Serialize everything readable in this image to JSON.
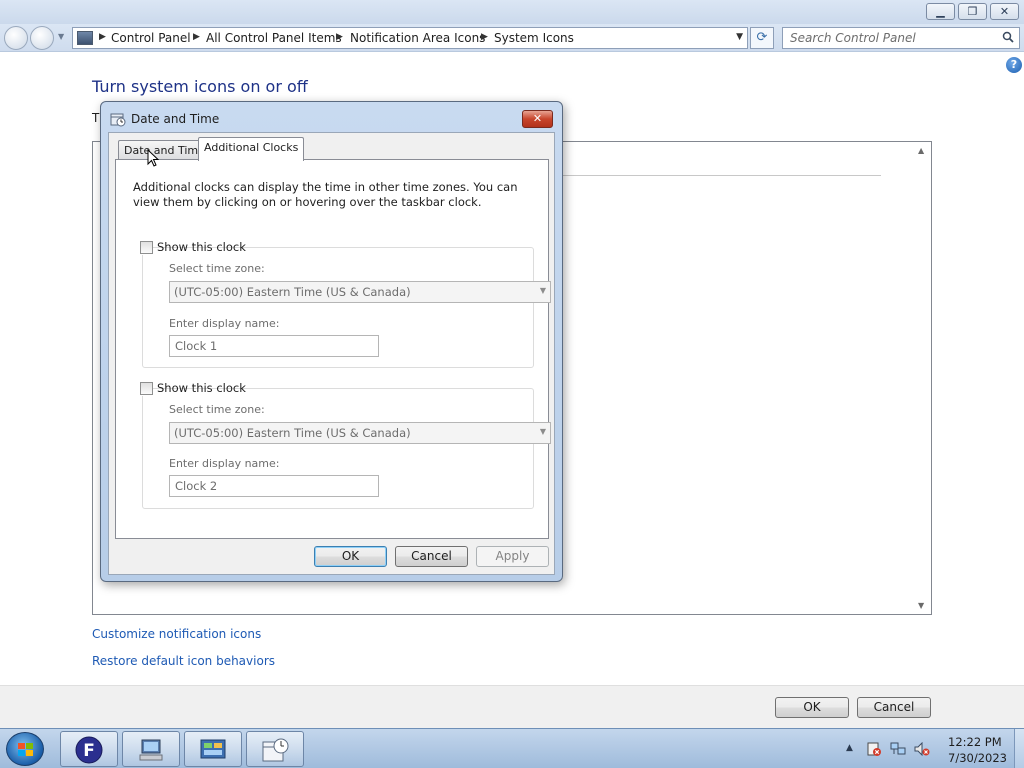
{
  "window": {
    "minimize_glyph": "▁",
    "maximize_glyph": "❐",
    "close_glyph": "✕"
  },
  "address_bar": {
    "breadcrumbs": [
      "Control Panel",
      "All Control Panel Items",
      "Notification Area Icons",
      "System Icons"
    ],
    "refresh_glyph": "⟳"
  },
  "search": {
    "placeholder": "Search Control Panel"
  },
  "content": {
    "help_glyph": "?",
    "title": "Turn system icons on or off",
    "subtitle": "T",
    "links": [
      "Customize notification icons",
      "Restore default icon behaviors"
    ]
  },
  "footer": {
    "ok_label": "OK",
    "cancel_label": "Cancel"
  },
  "dialog": {
    "title": "Date and Time",
    "close_glyph": "✕",
    "tabs": [
      "Date and Time",
      "Additional Clocks"
    ],
    "active_tab": "Additional Clocks",
    "description": "Additional clocks can display the time in other time zones. You can view them by clicking on or hovering over the taskbar clock.",
    "clocks": [
      {
        "checkbox_label": "Show this clock",
        "checked": false,
        "time_zone_label": "Select time zone:",
        "time_zone_value": "(UTC-05:00) Eastern Time (US & Canada)",
        "display_name_label": "Enter display name:",
        "display_name_value": "Clock 1"
      },
      {
        "checkbox_label": "Show this clock",
        "checked": false,
        "time_zone_label": "Select time zone:",
        "time_zone_value": "(UTC-05:00) Eastern Time (US & Canada)",
        "display_name_label": "Enter display name:",
        "display_name_value": "Clock 2"
      }
    ],
    "buttons": {
      "ok": "OK",
      "cancel": "Cancel",
      "apply": "Apply"
    }
  },
  "taskbar": {
    "pinned_icons": [
      "app-f-icon",
      "computer-management-icon",
      "control-panel-icon",
      "date-time-icon"
    ],
    "tray_icons": [
      "action-center-icon",
      "network-icon",
      "volume-muted-icon"
    ],
    "time": "12:22 PM",
    "date": "7/30/2023"
  }
}
